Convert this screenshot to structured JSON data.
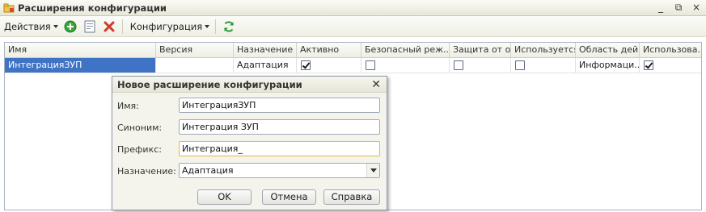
{
  "window": {
    "title": "Расширения конфигурации",
    "controls": [
      "_",
      "⧉",
      "×"
    ]
  },
  "toolbar": {
    "actions_label": "Действия",
    "config_label": "Конфигурация",
    "accent_add": "#3aa33a",
    "accent_delete": "#d03a2a"
  },
  "grid": {
    "columns": [
      "Имя",
      "Версия",
      "Назначение",
      "Активно",
      "Безопасный реж...",
      "Защита от о...",
      "Используется...",
      "Область дей...",
      "Использова..."
    ],
    "row": {
      "name": "ИнтеграцияЗУП",
      "version": "",
      "purpose": "Адаптация",
      "active": true,
      "safe_mode": false,
      "protection": false,
      "used": false,
      "scope": "Информаци...",
      "use": true
    }
  },
  "dialog": {
    "title": "Новое расширение конфигурации",
    "name_label": "Имя:",
    "name_value": "ИнтеграцияЗУП",
    "synonym_label": "Синоним:",
    "synonym_value": "Интеграция ЗУП",
    "prefix_label": "Префикс:",
    "prefix_value": "Интеграция_",
    "purpose_label": "Назначение:",
    "purpose_value": "Адаптация",
    "ok_label": "OK",
    "cancel_label": "Отмена",
    "help_label": "Справка",
    "close_glyph": "✕"
  },
  "colors": {
    "selection": "#3f73c5",
    "accent_border": "#e5b93a"
  }
}
